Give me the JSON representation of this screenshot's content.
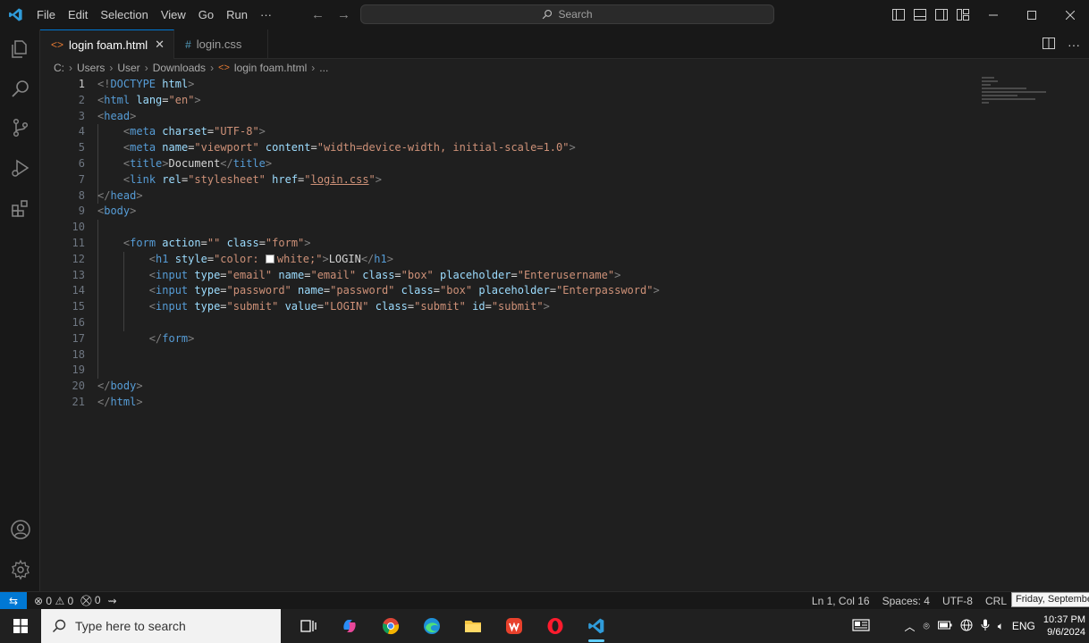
{
  "window": {
    "menu": [
      "File",
      "Edit",
      "Selection",
      "View",
      "Go",
      "Run",
      "···"
    ],
    "search_placeholder": "Search",
    "accent": "#0078d4"
  },
  "tabs": [
    {
      "label": "login foam.html",
      "icon": "html-file-icon",
      "active": true
    },
    {
      "label": "login.css",
      "icon": "css-file-icon",
      "active": false
    }
  ],
  "breadcrumb": [
    "C:",
    "Users",
    "User",
    "Downloads",
    "login foam.html",
    "..."
  ],
  "editor": {
    "current_line": 1,
    "line_numbers": [
      "1",
      "2",
      "3",
      "4",
      "5",
      "6",
      "7",
      "8",
      "9",
      "10",
      "11",
      "12",
      "13",
      "14",
      "15",
      "16",
      "17",
      "18",
      "19",
      "20",
      "21"
    ],
    "lines": [
      {
        "t": [
          [
            "t",
            "<!"
          ],
          [
            "n",
            "DOCTYPE"
          ],
          [
            "p",
            " "
          ],
          [
            "a",
            "html"
          ],
          [
            "t",
            ">"
          ]
        ]
      },
      {
        "t": [
          [
            "t",
            "<"
          ],
          [
            "n",
            "html"
          ],
          [
            "p",
            " "
          ],
          [
            "a",
            "lang"
          ],
          [
            "p",
            "="
          ],
          [
            "s",
            "\"en\""
          ],
          [
            "t",
            ">"
          ]
        ]
      },
      {
        "t": [
          [
            "t",
            "<"
          ],
          [
            "n",
            "head"
          ],
          [
            "t",
            ">"
          ]
        ]
      },
      {
        "t": [
          [
            "p",
            "    "
          ],
          [
            "t",
            "<"
          ],
          [
            "n",
            "meta"
          ],
          [
            "p",
            " "
          ],
          [
            "a",
            "charset"
          ],
          [
            "p",
            "="
          ],
          [
            "s",
            "\"UTF-8\""
          ],
          [
            "t",
            ">"
          ]
        ]
      },
      {
        "t": [
          [
            "p",
            "    "
          ],
          [
            "t",
            "<"
          ],
          [
            "n",
            "meta"
          ],
          [
            "p",
            " "
          ],
          [
            "a",
            "name"
          ],
          [
            "p",
            "="
          ],
          [
            "s",
            "\"viewport\""
          ],
          [
            "p",
            " "
          ],
          [
            "a",
            "content"
          ],
          [
            "p",
            "="
          ],
          [
            "s",
            "\"width=device-width, initial-scale=1.0\""
          ],
          [
            "t",
            ">"
          ]
        ]
      },
      {
        "t": [
          [
            "p",
            "    "
          ],
          [
            "t",
            "<"
          ],
          [
            "n",
            "title"
          ],
          [
            "t",
            ">"
          ],
          [
            "p",
            "Document"
          ],
          [
            "t",
            "</"
          ],
          [
            "n",
            "title"
          ],
          [
            "t",
            ">"
          ]
        ]
      },
      {
        "t": [
          [
            "p",
            "    "
          ],
          [
            "t",
            "<"
          ],
          [
            "n",
            "link"
          ],
          [
            "p",
            " "
          ],
          [
            "a",
            "rel"
          ],
          [
            "p",
            "="
          ],
          [
            "s",
            "\"stylesheet\""
          ],
          [
            "p",
            " "
          ],
          [
            "a",
            "href"
          ],
          [
            "p",
            "="
          ],
          [
            "s",
            "\""
          ],
          [
            "sl",
            "login.css"
          ],
          [
            "s",
            "\""
          ],
          [
            "t",
            ">"
          ]
        ]
      },
      {
        "t": [
          [
            "t",
            "</"
          ],
          [
            "n",
            "head"
          ],
          [
            "t",
            ">"
          ]
        ]
      },
      {
        "t": [
          [
            "t",
            "<"
          ],
          [
            "n",
            "body"
          ],
          [
            "t",
            ">"
          ]
        ]
      },
      {
        "t": []
      },
      {
        "t": [
          [
            "p",
            "    "
          ],
          [
            "t",
            "<"
          ],
          [
            "n",
            "form"
          ],
          [
            "p",
            " "
          ],
          [
            "a",
            "action"
          ],
          [
            "p",
            "="
          ],
          [
            "s",
            "\"\""
          ],
          [
            "p",
            " "
          ],
          [
            "a",
            "class"
          ],
          [
            "p",
            "="
          ],
          [
            "s",
            "\"form\""
          ],
          [
            "t",
            ">"
          ]
        ]
      },
      {
        "t": [
          [
            "p",
            "        "
          ],
          [
            "t",
            "<"
          ],
          [
            "n",
            "h1"
          ],
          [
            "p",
            " "
          ],
          [
            "a",
            "style"
          ],
          [
            "p",
            "="
          ],
          [
            "s",
            "\"color: "
          ],
          [
            "sw",
            ""
          ],
          [
            "s",
            "white;\""
          ],
          [
            "t",
            ">"
          ],
          [
            "p",
            "LOGIN"
          ],
          [
            "t",
            "</"
          ],
          [
            "n",
            "h1"
          ],
          [
            "t",
            ">"
          ]
        ]
      },
      {
        "t": [
          [
            "p",
            "        "
          ],
          [
            "t",
            "<"
          ],
          [
            "n",
            "input"
          ],
          [
            "p",
            " "
          ],
          [
            "a",
            "type"
          ],
          [
            "p",
            "="
          ],
          [
            "s",
            "\"email\""
          ],
          [
            "p",
            " "
          ],
          [
            "a",
            "name"
          ],
          [
            "p",
            "="
          ],
          [
            "s",
            "\"email\""
          ],
          [
            "p",
            " "
          ],
          [
            "a",
            "class"
          ],
          [
            "p",
            "="
          ],
          [
            "s",
            "\"box\""
          ],
          [
            "p",
            " "
          ],
          [
            "a",
            "placeholder"
          ],
          [
            "p",
            "="
          ],
          [
            "s",
            "\"Enterusername\""
          ],
          [
            "t",
            ">"
          ]
        ]
      },
      {
        "t": [
          [
            "p",
            "        "
          ],
          [
            "t",
            "<"
          ],
          [
            "n",
            "input"
          ],
          [
            "p",
            " "
          ],
          [
            "a",
            "type"
          ],
          [
            "p",
            "="
          ],
          [
            "s",
            "\"password\""
          ],
          [
            "p",
            " "
          ],
          [
            "a",
            "name"
          ],
          [
            "p",
            "="
          ],
          [
            "s",
            "\"password\""
          ],
          [
            "p",
            " "
          ],
          [
            "a",
            "class"
          ],
          [
            "p",
            "="
          ],
          [
            "s",
            "\"box\""
          ],
          [
            "p",
            " "
          ],
          [
            "a",
            "placeholder"
          ],
          [
            "p",
            "="
          ],
          [
            "s",
            "\"Enterpassword\""
          ],
          [
            "t",
            ">"
          ]
        ]
      },
      {
        "t": [
          [
            "p",
            "        "
          ],
          [
            "t",
            "<"
          ],
          [
            "n",
            "input"
          ],
          [
            "p",
            " "
          ],
          [
            "a",
            "type"
          ],
          [
            "p",
            "="
          ],
          [
            "s",
            "\"submit\""
          ],
          [
            "p",
            " "
          ],
          [
            "a",
            "value"
          ],
          [
            "p",
            "="
          ],
          [
            "s",
            "\"LOGIN\""
          ],
          [
            "p",
            " "
          ],
          [
            "a",
            "class"
          ],
          [
            "p",
            "="
          ],
          [
            "s",
            "\"submit\""
          ],
          [
            "p",
            " "
          ],
          [
            "a",
            "id"
          ],
          [
            "p",
            "="
          ],
          [
            "s",
            "\"submit\""
          ],
          [
            "t",
            ">"
          ]
        ]
      },
      {
        "t": []
      },
      {
        "t": [
          [
            "p",
            "        "
          ],
          [
            "t",
            "</"
          ],
          [
            "n",
            "form"
          ],
          [
            "t",
            ">"
          ]
        ]
      },
      {
        "t": []
      },
      {
        "t": []
      },
      {
        "t": [
          [
            "t",
            "</"
          ],
          [
            "n",
            "body"
          ],
          [
            "t",
            ">"
          ]
        ]
      },
      {
        "t": [
          [
            "t",
            "</"
          ],
          [
            "n",
            "html"
          ],
          [
            "t",
            ">"
          ]
        ]
      }
    ]
  },
  "status": {
    "errors": "0",
    "warnings": "0",
    "ports": "0",
    "position": "Ln 1, Col 16",
    "spaces": "Spaces: 4",
    "encoding": "UTF-8",
    "eol": "CRL",
    "tooltip": "Friday, Septembe"
  },
  "taskbar": {
    "search_placeholder": "Type here to search",
    "language": "ENG",
    "time": "10:37 PM",
    "date": "9/6/2024"
  }
}
